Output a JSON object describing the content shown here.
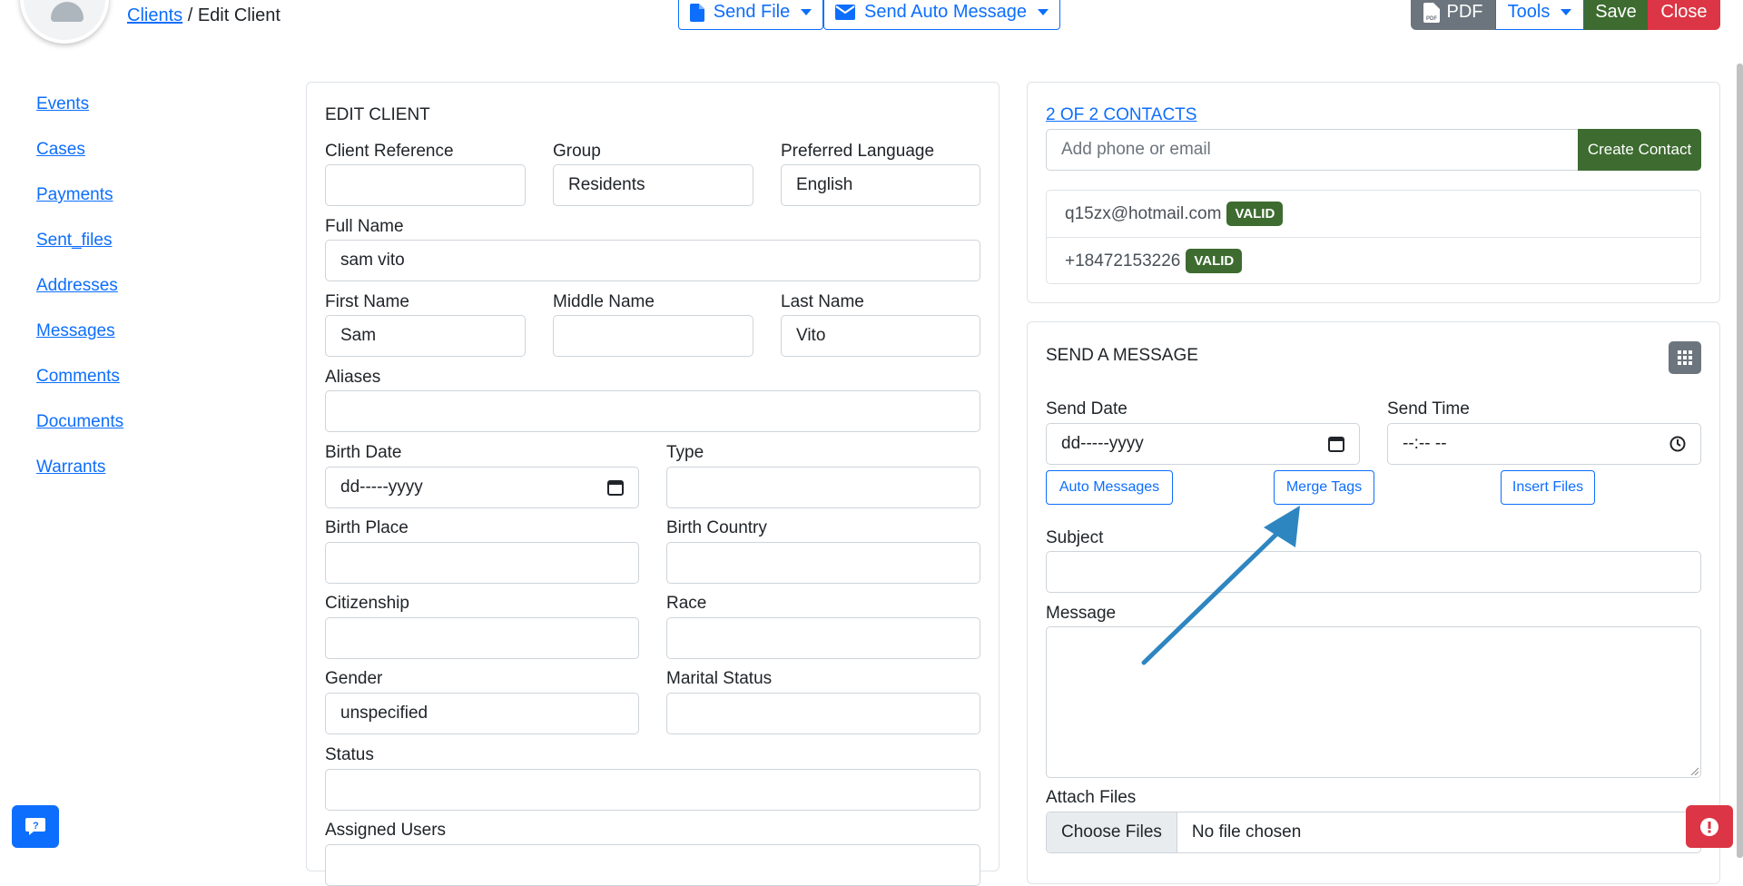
{
  "header": {
    "breadcrumb_link": "Clients",
    "breadcrumb_sep": " / ",
    "breadcrumb_current": "Edit Client",
    "send_file": "Send File",
    "send_auto_message": "Send Auto Message",
    "pdf": "PDF",
    "tools": "Tools",
    "save": "Save",
    "close": "Close"
  },
  "sidebar": {
    "items": [
      {
        "label": "Events"
      },
      {
        "label": "Cases"
      },
      {
        "label": "Payments"
      },
      {
        "label": "Sent_files"
      },
      {
        "label": "Addresses"
      },
      {
        "label": "Messages"
      },
      {
        "label": "Comments"
      },
      {
        "label": "Documents"
      },
      {
        "label": "Warrants"
      }
    ]
  },
  "edit_client": {
    "title": "EDIT CLIENT",
    "client_reference": {
      "label": "Client Reference",
      "value": ""
    },
    "group": {
      "label": "Group",
      "value": "Residents"
    },
    "preferred_language": {
      "label": "Preferred Language",
      "value": "English"
    },
    "full_name": {
      "label": "Full Name",
      "value": "sam vito"
    },
    "first_name": {
      "label": "First Name",
      "value": "Sam"
    },
    "middle_name": {
      "label": "Middle Name",
      "value": ""
    },
    "last_name": {
      "label": "Last Name",
      "value": "Vito"
    },
    "aliases": {
      "label": "Aliases",
      "value": ""
    },
    "birth_date": {
      "label": "Birth Date",
      "value": "dd-----yyyy"
    },
    "type": {
      "label": "Type",
      "value": ""
    },
    "birth_place": {
      "label": "Birth Place",
      "value": ""
    },
    "birth_country": {
      "label": "Birth Country",
      "value": ""
    },
    "citizenship": {
      "label": "Citizenship",
      "value": ""
    },
    "race": {
      "label": "Race",
      "value": ""
    },
    "gender": {
      "label": "Gender",
      "value": "unspecified"
    },
    "marital_status": {
      "label": "Marital Status",
      "value": ""
    },
    "status": {
      "label": "Status",
      "value": ""
    },
    "assigned_users": {
      "label": "Assigned Users",
      "value": ""
    }
  },
  "contacts": {
    "title": "2 OF 2 CONTACTS",
    "input_placeholder": "Add phone or email",
    "create_button": "Create Contact",
    "items": [
      {
        "value": "q15zx@hotmail.com",
        "badge": "VALID"
      },
      {
        "value": "+18472153226",
        "badge": "VALID"
      }
    ]
  },
  "send_message": {
    "title": "SEND A MESSAGE",
    "send_date_label": "Send Date",
    "send_date_value": "dd-----yyyy",
    "send_time_label": "Send Time",
    "send_time_value": "--:-- --",
    "auto_messages": "Auto Messages",
    "merge_tags": "Merge Tags",
    "insert_files": "Insert Files",
    "subject_label": "Subject",
    "message_label": "Message",
    "attach_label": "Attach Files",
    "choose_files": "Choose Files",
    "no_file": "No file chosen"
  },
  "colors": {
    "primary": "#0d6efd",
    "success": "#3d6b30",
    "danger": "#dc3545",
    "secondary": "#6c757d",
    "arrow": "#2e86c1"
  }
}
